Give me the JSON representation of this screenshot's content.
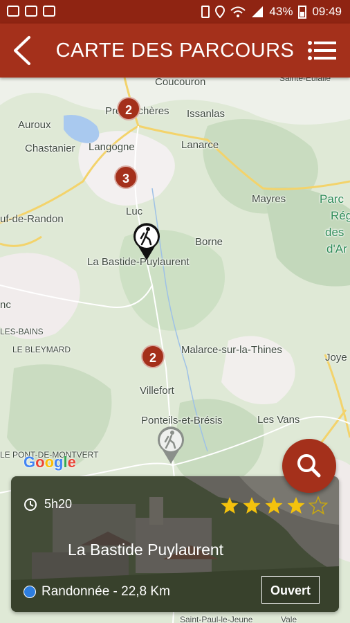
{
  "status_bar": {
    "battery": "43%",
    "time": "09:49"
  },
  "header": {
    "title": "CARTE DES PARCOURS"
  },
  "map": {
    "places": [
      "Coucouron",
      "Sainte-Eulalie",
      "Prévenchères",
      "Issanlas",
      "Auroux",
      "Chastanier",
      "Langogne",
      "Lanarce",
      "Mayres",
      "Parc",
      "Régi",
      "des",
      "d'Ar",
      "uf-de-Randon",
      "Luc",
      "Borne",
      "La Bastide-Puylaurent",
      "nc",
      "LES-BAINS",
      "LE BLEYMARD",
      "Malarce-sur-la-Thines",
      "Joye",
      "Villefort",
      "Ponteils-et-Brésis",
      "Les Vans",
      "LE PONT-DE-MONTVERT",
      "Saint-Paul-le-Jeune",
      "Vale"
    ],
    "clusters": [
      {
        "count": "2"
      },
      {
        "count": "3"
      },
      {
        "count": "2"
      }
    ]
  },
  "card": {
    "duration": "5h20",
    "rating": 4,
    "max_rating": 5,
    "title": "La Bastide Puylaurent",
    "activity": "Randonnée - 22,8 Km",
    "open_label": "Ouvert"
  },
  "colors": {
    "brand": "#a4301b",
    "status": "#8f2412",
    "star": "#f4c20d",
    "activity_dot": "#2d7de0"
  }
}
